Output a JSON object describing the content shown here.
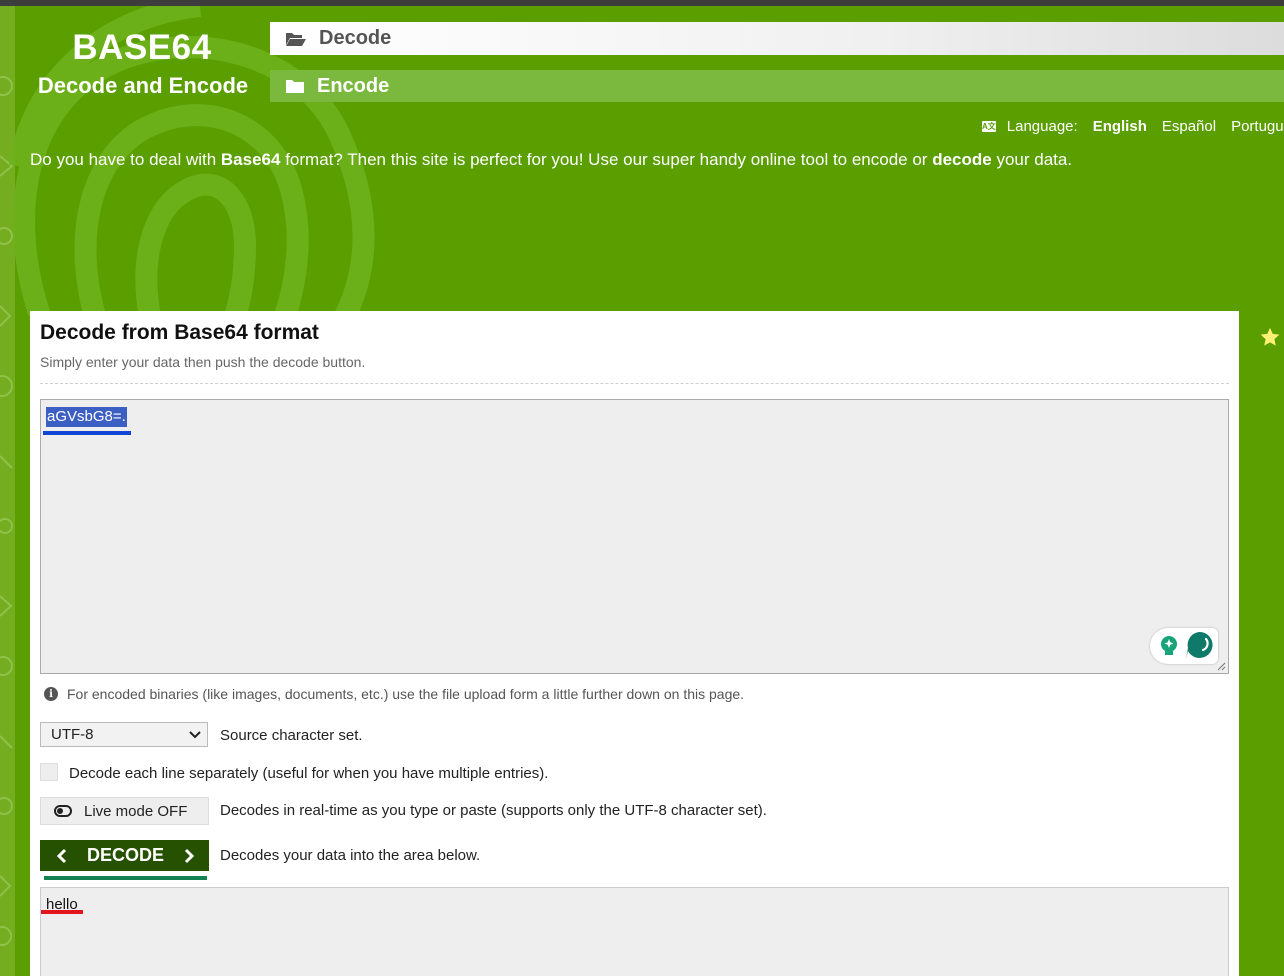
{
  "header": {
    "logo_title": "BASE64",
    "logo_subtitle": "Decode and Encode",
    "nav": [
      {
        "label": "Decode",
        "icon": "folder-open-icon",
        "active": true
      },
      {
        "label": "Encode",
        "icon": "folder-icon",
        "active": false
      }
    ],
    "language": {
      "icon": "translate-icon",
      "icon_text": "A文",
      "label": "Language:",
      "options": [
        "English",
        "Español",
        "Portugu"
      ],
      "selected": "English"
    },
    "intro": {
      "part1": "Do you have to deal with ",
      "bold1": "Base64",
      "part2": " format? Then this site is perfect for you! Use our super handy online tool to encode or ",
      "bold2": "decode",
      "part3": " your data."
    }
  },
  "panel": {
    "title": "Decode from Base64 format",
    "subtitle": "Simply enter your data then push the decode button.",
    "input_value": "aGVsbG8=.",
    "hint": "For encoded binaries (like images, documents, etc.) use the file upload form a little further down on this page.",
    "charset": {
      "value": "UTF-8",
      "label": "Source character set."
    },
    "line_separately": {
      "checked": false,
      "label": "Decode each line separately (useful for when you have multiple entries)."
    },
    "live_mode": {
      "label": "Live mode OFF",
      "description": "Decodes in real-time as you type or paste (supports only the UTF-8 character set)."
    },
    "decode_button": {
      "label": "DECODE",
      "description": "Decodes your data into the area below."
    },
    "output_value": "hello"
  },
  "colors": {
    "background_green": "#5a9e00",
    "decode_button": "#265100",
    "input_highlight": "#3c5fc3",
    "input_underline": "#0f46d6",
    "button_underline": "#148252",
    "output_underline": "#e1151b"
  }
}
